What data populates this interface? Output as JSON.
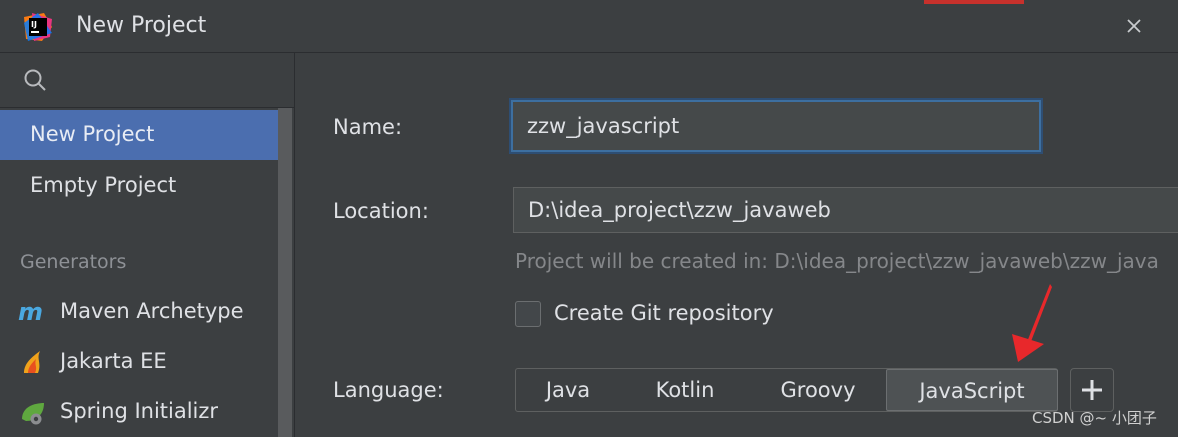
{
  "window": {
    "title": "New Project"
  },
  "sidebar": {
    "items": [
      {
        "label": "New Project"
      },
      {
        "label": "Empty Project"
      }
    ],
    "section_label": "Generators",
    "generators": [
      {
        "label": "Maven Archetype",
        "icon": "maven-icon"
      },
      {
        "label": "Jakarta EE",
        "icon": "jakarta-ee-icon"
      },
      {
        "label": "Spring Initializr",
        "icon": "spring-icon"
      }
    ]
  },
  "form": {
    "name_label": "Name:",
    "name_value": "zzw_javascript",
    "location_label": "Location:",
    "location_value": "D:\\idea_project\\zzw_javaweb",
    "hint": "Project will be created in: D:\\idea_project\\zzw_javaweb\\zzw_java",
    "git_label": "Create Git repository",
    "git_checked": false,
    "language_label": "Language:",
    "languages": [
      "Java",
      "Kotlin",
      "Groovy",
      "JavaScript"
    ],
    "selected_language": "JavaScript",
    "add_label": "+"
  },
  "watermark": "CSDN @~ 小团子",
  "colors": {
    "selection": "#4b6eaf",
    "annotation_arrow": "#e8282b",
    "background": "#3c3f41"
  }
}
